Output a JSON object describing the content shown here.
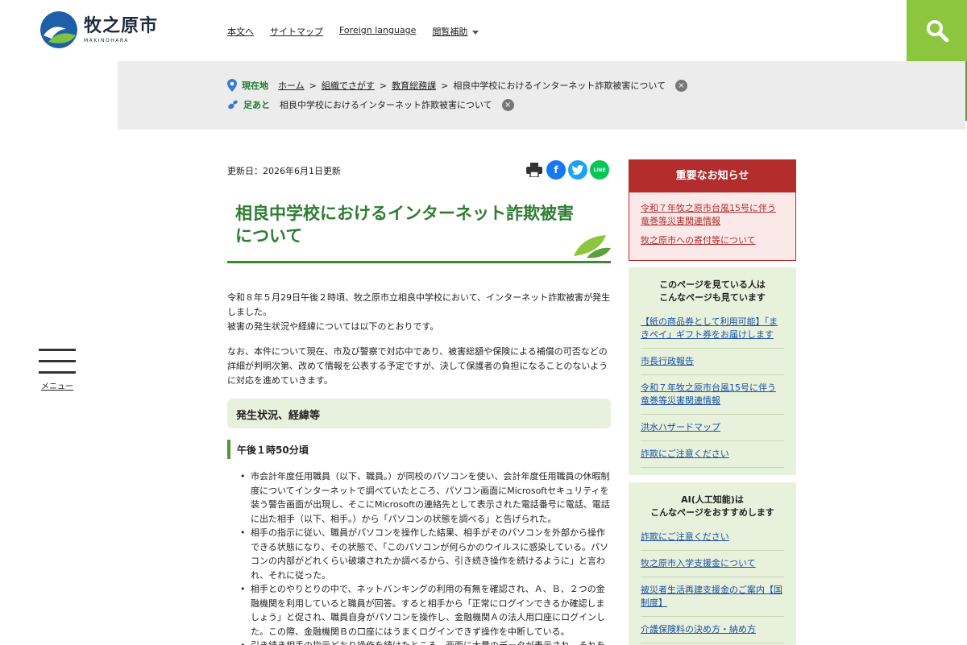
{
  "site": {
    "name": "牧之原市",
    "name_en": "MAKINOHARA"
  },
  "top_nav": [
    {
      "label": "本文へ"
    },
    {
      "label": "サイトマップ"
    },
    {
      "label": "Foreign language"
    },
    {
      "label": "閲覧補助"
    }
  ],
  "breadcrumb": {
    "current_label": "現在地",
    "home": "ホーム",
    "sep": ">",
    "level1": "組織でさがす",
    "level2": "教育総務課",
    "current": "相良中学校におけるインターネット詐欺被害について",
    "history_label": "足あと",
    "history_item": "相良中学校におけるインターネット詐欺被害について",
    "close_glyph": "×"
  },
  "menu_label": "メニュー",
  "updated": "更新日：2026年6月1日更新",
  "share": {
    "facebook": "f",
    "line": "LINE"
  },
  "title": "相良中学校におけるインターネット詐欺被害について",
  "intro": [
    "令和８年５月29日午後２時頃、牧之原市立相良中学校において、インターネット詐欺被害が発生しました。",
    "被害の発生状況や経緯については以下のとおりです。"
  ],
  "para2": "なお、本件について現在、市及び警察で対応中であり、被害総額や保険による補償の可否などの詳細が判明次第、改めて情報を公表する予定ですが、決して保護者の負担になることのないように対応を進めていきます。",
  "section_heading": "発生状況、経緯等",
  "sub_heading": "午後１時50分頃",
  "list_items": [
    "市会計年度任用職員（以下、職員。）が同校のパソコンを使い、会計年度任用職員の休暇制度についてインターネットで調べていたところ、パソコン画面にMicrosoftセキュリティを装う警告画面が出現し、そこにMicrosoftの連絡先として表示された電話番号に電話、電話に出た相手（以下、相手。）から「パソコンの状態を調べる」と告げられた。",
    "相手の指示に従い、職員がパソコンを操作した結果、相手がそのパソコンを外部から操作できる状態になり、その状態で、「このパソコンが何らかのウイルスに感染している。パソコンの内部がどれくらい破壊されたか調べるから、引き続き操作を続けるように」と言われ、それに従った。",
    "相手とのやりとりの中で、ネットバンキングの利用の有無を確認され、Ａ、Ｂ、２つの金融機関を利用していると職員が回答。すると相手から「正常にログインできるか確認しましょう」と促され、職員自身がパソコンを操作し、金融機関Ａの法人用口座にログインした。この際、金融機関Ｂの口座にはうまくログインできず操作を中断している。",
    "引き続き相手の指示どおり操作を続けたところ、画面に大量のデータが表示され、それを"
  ],
  "sidebar": {
    "notice_title": "重要なお知らせ",
    "notice_items": [
      "令和７年牧之原市台風15号に伴う竜巻等災害関連情報",
      "牧之原市への寄付等について"
    ],
    "viewed_title_1": "このページを見ている人は",
    "viewed_title_2": "こんなページも見ています",
    "viewed_links": [
      "【紙の商品券として利用可能】「まきペイ」ギフト券をお届けします",
      "市長行政報告",
      "令和７年牧之原市台風15号に伴う竜巻等災害関連情報",
      "洪水ハザードマップ",
      "詐欺にご注意ください"
    ],
    "ai_title_1": "AI(人工知能)は",
    "ai_title_2": "こんなページをおすすめします",
    "ai_links": [
      "詐欺にご注意ください",
      "牧之原市入学支援金について",
      "被災者生活再建支援金のご案内【国制度】",
      "介護保険料の決め方・納め方"
    ]
  },
  "colors": {
    "green_light": "#8cc63f",
    "green_dark": "#5aa03c",
    "title_green": "#2e7d32",
    "notice_red": "#b32d2d",
    "panel_bg": "#e8f1dc",
    "link_blue": "#1a4fa3"
  }
}
